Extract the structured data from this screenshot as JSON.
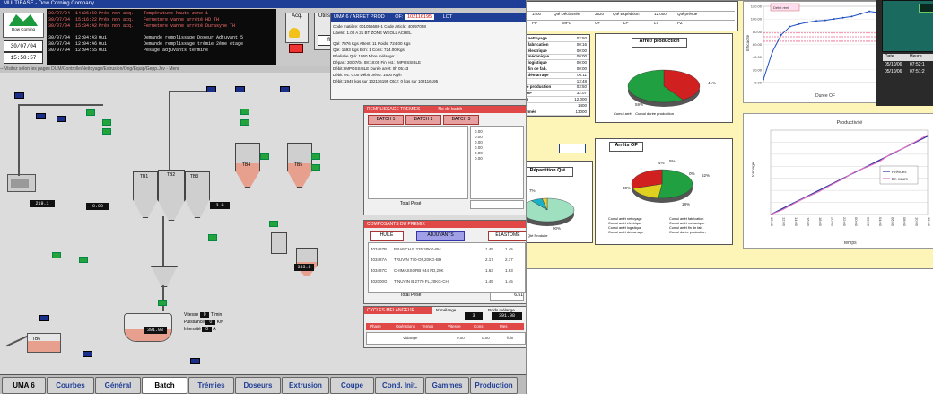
{
  "scada": {
    "title": "MULTIBASE - Dow Corning Company",
    "logo_text": "Dow Corning",
    "dates": [
      "30/07/04",
      "30/07/04",
      "15:58:57"
    ],
    "alarms": [
      {
        "date": "30/07/04",
        "time": "14:26:59",
        "status": "Prés non acq.",
        "message": "Température haute zone 1"
      },
      {
        "date": "30/07/04",
        "time": "15:16:22",
        "status": "Prés non acq.",
        "message": "Fermeture vanne arrêté HD TH"
      },
      {
        "date": "30/07/04",
        "time": "15:34:42",
        "status": "Prés non acq.",
        "message": "Fermeture vanne arrêté Durasyne TH"
      },
      {
        "date": "30/07/04",
        "time": "12:04:43",
        "status": "Oui",
        "message": "Demande remplissage Doseur Adjuvant 5"
      },
      {
        "date": "30/07/04",
        "time": "12:04:46",
        "status": "Oui",
        "message": "Demande remplissage trémie 2ème étage"
      },
      {
        "date": "30/07/04",
        "time": "12:04:55",
        "status": "Oui",
        "message": "Pesage adjuvants terminé"
      }
    ],
    "acq_label": "Acq.",
    "util_label": "Utilisateur.",
    "util_value": "fltc",
    "nav_text": "---Visitez selon les pages DUM/Controlle/Nettoyage/Extrusion/Ong/Equip/Gepp.Jsv - Menr",
    "uma_panel": {
      "title": "UMA 6 / ARRET PROD",
      "of_label": "OF:",
      "of_value": "102116195",
      "lot_label": "LOT",
      "lines": [
        "Code matière: 001056688-1   Code article: 40097058",
        "Libellé: 1.00 A 21 BT ZONE WEOLL ACHEL",
        "Qté: 7976 Kgs   Attent: 11   Poids: 724.00 Kgs",
        "Qté: 1593 Kgs   Ech: 1   Cons: 724.00 Kgs",
        "Réalisée Qté: 1950   Nbre mélange: 1",
        "Départ: 30/07/04 08:18:05   Fin est.: IMPOSSIBLE",
        "Débit: IMPOSSIBLE   Durée arrêt: 0h 05:43",
        "Débit rec: 0:00   Débit prévu: 1500 Kg/h",
        "Débit: 1949 kgs sur 102116195   Qtc2: 0 kgs sur 102116195"
      ]
    },
    "batch": {
      "header": "REMPLISSAGE TREMIES",
      "tabs": [
        "BATCH 1",
        "BATCH 2",
        "BATCH 3"
      ],
      "no_batch_label": "No de batch",
      "total_label": "Total Pesé",
      "values": [
        "0.00",
        "0.00",
        "0.00",
        "0.00",
        "0.00",
        "0.00"
      ]
    },
    "components": {
      "header": "COMPOSANTS DU PREMIX",
      "tabs": [
        "HUILE",
        "ADJUVANTS",
        "ELASTOME"
      ],
      "rows": [
        {
          "code": "403487B",
          "name": "BRANCH.B 225,20KG-BH",
          "v1": "1.45",
          "v2": "1.45"
        },
        {
          "code": "403487A",
          "name": "TRUV/N 770-OF,20KG-BH",
          "v1": "2.17",
          "v2": "2.17"
        },
        {
          "code": "403487C",
          "name": "CHIMASSORB 944 FD,20K",
          "v1": "1.63",
          "v2": "1.63"
        },
        {
          "code": "402000G",
          "name": "TINUVIN B 2770 FL,20KG-CH",
          "v1": "1.45",
          "v2": "1.45"
        }
      ],
      "total_label": "Total Pesé",
      "total": "6.51"
    },
    "cycle": {
      "header": "CYCLES MELANGEUR",
      "melange_label": "N°mélange",
      "melange_value": "3",
      "poids_label": "Poids mélange",
      "poids_value": "391.08",
      "columns": [
        "Phase",
        "Opérations",
        "Temps",
        "Vitesse",
        "Cons",
        "Mes"
      ],
      "row_label": "Vidange",
      "row_values": [
        "0:00",
        "0:00",
        "foin"
      ]
    },
    "hmi_readouts": {
      "mixer": "391.08",
      "tank_left": "219.1",
      "silo_left": "0.00",
      "silo_right": "3.0",
      "hopper": "333.8",
      "vitesse_label": "Vitesse",
      "vitesse_value": "0",
      "vitesse_unit": "T/min",
      "puissance_label": "Puissance",
      "puissance_value": "0",
      "puissance_unit": "Kw",
      "intensite_label": "Intensité",
      "intensite_value": "0",
      "intensite_unit": "A",
      "labels": [
        "TB1",
        "TB2",
        "TB3",
        "TB4",
        "TB5",
        "TB6"
      ]
    },
    "bottom_tabs": [
      "UMA 6",
      "Courbes",
      "Général",
      "Batch",
      "Trémies",
      "Doseurs",
      "Extrusion",
      "Coupe",
      "Cond. Init.",
      "Gammes",
      "Production"
    ],
    "active_tab": "Batch"
  },
  "report": {
    "top_rows": [
      [
        "01:00",
        "",
        "",
        "",
        "",
        "",
        ""
      ],
      [
        "Qté Rebut",
        "1400",
        "Qté Déclassée",
        "2520",
        "Qté Expédition",
        "12.000",
        "Qté prévue"
      ],
      [
        "Opérations",
        "PP",
        "MPC",
        "OF",
        "LP",
        "LT",
        "PZ"
      ]
    ],
    "cumul_labels": [
      "Cumul arrêt nettoyage",
      "Cumul arrêt fabrication",
      "Cumul arrêt électrique",
      "Cumul arrêt mécanique",
      "Cumul arrêt logistique",
      "Cumul arrêt fin de fab.",
      "Cumul arrêt démarrage",
      "Cumul arrêt",
      "Cumul durée production",
      "Durée total OF",
      "Qté Produite",
      "Qté Rebut",
      "Qté Consommée"
    ],
    "cumul_values": [
      "02:50",
      "00:16",
      "00:00",
      "00:00",
      "00:00",
      "00:00",
      "00:11",
      "13:48",
      "03:50",
      "32:07",
      "12.000",
      "1400",
      "13000"
    ],
    "arret_title": "Arrêt/ production",
    "arret_slices": [
      {
        "label": "Cumul arrêt",
        "percent": 41,
        "color": "#d02020"
      },
      {
        "label": "Cumul durée production",
        "percent": 59,
        "color": "#20a040"
      }
    ],
    "arret_pct_labels": [
      "41%",
      "59%"
    ],
    "arret_legend": [
      "Cumul arrêt",
      "Cumul durée production"
    ],
    "repartition_title": "Répartition Qté",
    "repartition_slices": [
      {
        "label": "Qté Produite",
        "percent": 90,
        "color": "#9fe0c0"
      },
      {
        "label": "Qté Rebut",
        "percent": 7,
        "color": "#19b0c8"
      },
      {
        "label": "Qté Déclassée",
        "percent": 3,
        "color": "#f0d030"
      }
    ],
    "repartition_pct_labels": [
      "7%",
      "90%"
    ],
    "repartition_legend": [
      "Qté Produite"
    ],
    "arretsof_title": "Arrêts OF",
    "arretsof_slices": [
      {
        "label": "Cumul arrêt nettoyage",
        "percent": 52,
        "color": "#20a040"
      },
      {
        "label": "Cumul arrêt fabrication",
        "percent": 18,
        "color": "#e0d020"
      },
      {
        "label": "Cumul arrêt électrique",
        "percent": 30,
        "color": "#d02020"
      }
    ],
    "arretsof_pct_labels": [
      "4%",
      "5%",
      "52%",
      "0%",
      "30%",
      "18%"
    ],
    "arretsof_legend": [
      "Cumul arrêt nettoyage",
      "Cumul arrêt fabrication",
      "Cumul arrêt électrique",
      "Cumul arrêt mécanique",
      "Cumul arrêt logistique",
      "Cumul arrêt fin de fab.",
      "Cumul arrêt démarrage",
      "Cumul durée production"
    ],
    "efficacite": {
      "ylabel": "Efficacité",
      "xlabel": "Durée OF",
      "yticks": [
        "0.00",
        "20.00",
        "40.00",
        "60.00",
        "80.00",
        "100.00",
        "120.00"
      ],
      "legend": [
        "Débit réel"
      ],
      "header_label": "Débit réel"
    },
    "productivite": {
      "title": "Productivité",
      "ylabel": "tonnage",
      "xlabel": "temps",
      "xticks": [
        "10:00",
        "12:00",
        "14:00",
        "16:00",
        "18:00",
        "20:00",
        "22:00",
        "00:00",
        "02:00",
        "04:00",
        "06:00",
        "08:00",
        "10:00",
        "12:00"
      ],
      "legend": [
        "Prévues",
        "En cours"
      ]
    },
    "dark_table": {
      "headers": [
        "Date",
        "Heure"
      ],
      "rows": [
        [
          "05/10/06",
          "07:52:1"
        ],
        [
          "05/10/06",
          "07:51:2"
        ]
      ]
    }
  },
  "chart_data": [
    {
      "type": "line",
      "title": "",
      "xlabel": "Durée OF",
      "ylabel": "Efficacité",
      "ylim": [
        0,
        120
      ],
      "series": [
        {
          "name": "Débit réel",
          "values": [
            5,
            48,
            75,
            88,
            92,
            95,
            97,
            98,
            100,
            102,
            104,
            108,
            112,
            110
          ]
        }
      ]
    },
    {
      "type": "line",
      "title": "Productivité",
      "xlabel": "temps",
      "ylabel": "tonnage",
      "categories": [
        "10:00",
        "12:00",
        "14:00",
        "16:00",
        "18:00",
        "20:00",
        "22:00",
        "00:00",
        "02:00",
        "04:00",
        "06:00",
        "08:00",
        "10:00",
        "12:00"
      ],
      "series": [
        {
          "name": "Prévues",
          "values": [
            0,
            1,
            2,
            3,
            4,
            5,
            6,
            7,
            8,
            9,
            10,
            11,
            12,
            13
          ]
        },
        {
          "name": "En cours",
          "values": [
            0,
            0.8,
            1.9,
            2.9,
            3.8,
            4.9,
            5.9,
            7.1,
            7.9,
            8.8,
            10.1,
            11,
            12.1,
            13.2
          ]
        }
      ]
    }
  ]
}
